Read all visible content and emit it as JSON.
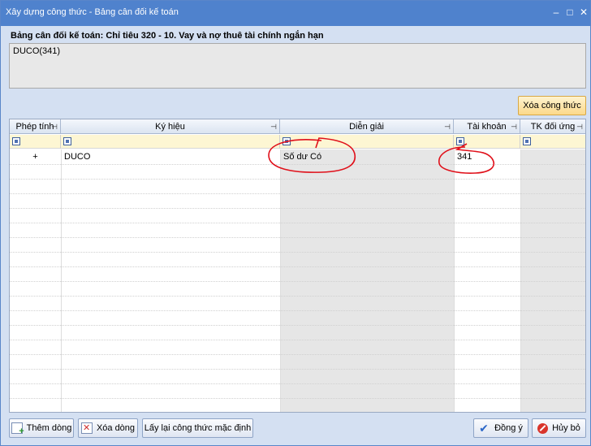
{
  "window": {
    "title": "Xây dựng công thức - Bảng cân đối kế toán",
    "controls": {
      "minimize": "–",
      "maximize": "□",
      "close": "✕"
    }
  },
  "heading": "Bảng cân đối kế toán: Chỉ tiêu 320 - 10. Vay và nợ thuê tài chính ngắn hạn",
  "formula": "DUCO(341)",
  "toolbar": {
    "clear_formula_label": "Xóa công thức"
  },
  "grid": {
    "columns": [
      {
        "key": "operator",
        "label": "Phép tính"
      },
      {
        "key": "symbol",
        "label": "Ký hiệu"
      },
      {
        "key": "description",
        "label": "Diễn giải"
      },
      {
        "key": "account",
        "label": "Tài khoản"
      },
      {
        "key": "contra",
        "label": "TK đối ứng"
      }
    ],
    "pin_glyph": "⊣",
    "rows": [
      {
        "operator": "+",
        "symbol": "DUCO",
        "description": "Số dư Có",
        "account": "341",
        "contra": ""
      }
    ]
  },
  "footer": {
    "add_row_label": "Thêm dòng",
    "delete_row_label": "Xóa dòng",
    "reset_label": "Lấy lại công thức mặc định",
    "ok_label": "Đồng ý",
    "cancel_label": "Hủy bỏ"
  },
  "icons": {
    "add_row": "add-row-icon",
    "delete_row": "delete-row-icon",
    "ok": "checkmark-icon",
    "cancel": "cancel-icon"
  },
  "colors": {
    "titlebar": "#4f82cd",
    "window_bg": "#d4e0f2",
    "filter_row": "#fdf6d3",
    "annotation": "#e0101a"
  }
}
